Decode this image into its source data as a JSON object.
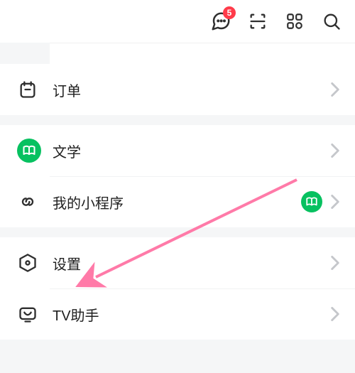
{
  "header": {
    "messageBadge": "5"
  },
  "menu": {
    "orders": "订单",
    "literature": "文学",
    "miniApps": "我的小程序",
    "settings": "设置",
    "tvHelper": "TV助手"
  }
}
